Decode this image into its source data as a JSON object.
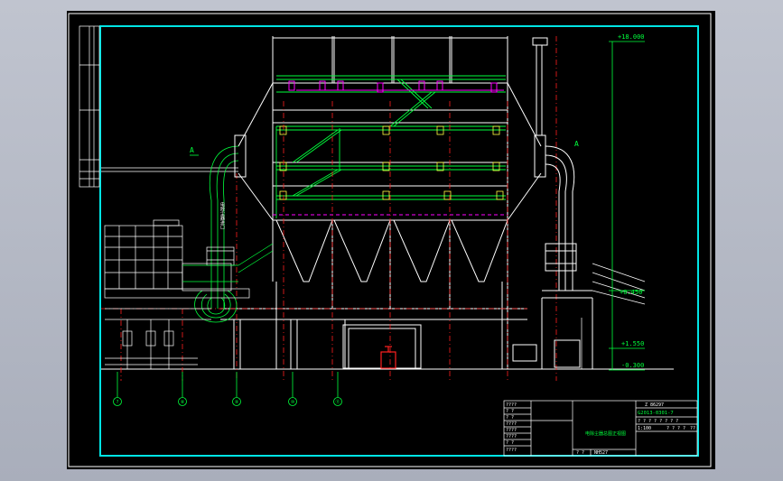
{
  "drawing": {
    "title_block": {
      "code_top": "Z 86297",
      "drawing_no": "G2013-0301-7",
      "scale": "1:100",
      "sheet": "??",
      "title": "电除尘器总图正视图",
      "footer_left": "? ?",
      "footer_mid": "NH527",
      "rows_left": [
        "????",
        "? ?",
        "? ?",
        "????",
        "????",
        "????",
        "? ?",
        "????"
      ],
      "rows_right_a": "? ? ? ? ? ? ? ?",
      "rows_right_b": "? ? ? ?"
    },
    "elevations": [
      {
        "label": "+18.000"
      },
      {
        "label": "+8.450"
      },
      {
        "label": "+1.550"
      },
      {
        "label": "-0.300"
      }
    ],
    "axis_markers": [
      "?",
      "⑧",
      "⑨",
      "⑩",
      "⑪"
    ],
    "side_labels": {
      "inlet_arrow": "A",
      "outlet_arrow": "A",
      "vertical_text": "电除尘器进口"
    }
  },
  "colors": {
    "frame": "#00e5e5",
    "white": "#ffffff",
    "green": "#00ff3c",
    "magenta": "#ff00ff",
    "red": "#ff2020",
    "yellow": "#ffff40"
  }
}
